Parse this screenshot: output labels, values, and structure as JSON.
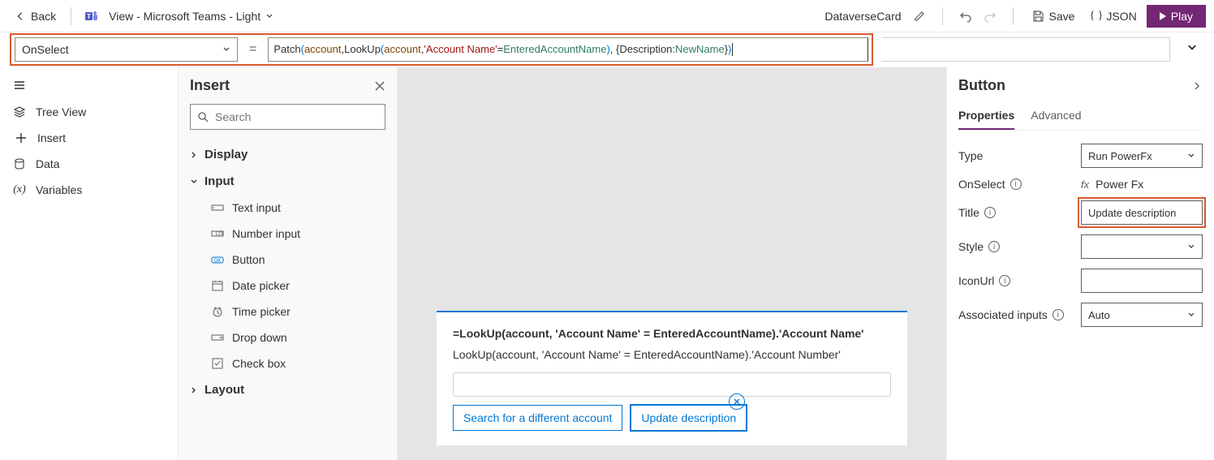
{
  "top": {
    "back": "Back",
    "view": "View - Microsoft Teams - Light",
    "dataverse": "DataverseCard",
    "save": "Save",
    "json": "JSON",
    "play": "Play"
  },
  "formula": {
    "property": "OnSelect",
    "fn1": "Patch",
    "ds": "account",
    "fn2": "LookUp",
    "field": "'Account Name'",
    "var1": "EnteredAccountName",
    "prop": "Description",
    "var2": "NewName"
  },
  "rail": {
    "treeview": "Tree View",
    "insert": "Insert",
    "data": "Data",
    "variables": "Variables"
  },
  "insert": {
    "title": "Insert",
    "search_placeholder": "Search",
    "cat_display": "Display",
    "cat_input": "Input",
    "cat_layout": "Layout",
    "items": {
      "text_input": "Text input",
      "number_input": "Number input",
      "button": "Button",
      "date_picker": "Date picker",
      "time_picker": "Time picker",
      "drop_down": "Drop down",
      "check_box": "Check box"
    }
  },
  "card": {
    "line1": "=LookUp(account, 'Account Name' = EnteredAccountName).'Account Name'",
    "line2": "LookUp(account, 'Account Name' = EnteredAccountName).'Account Number'",
    "btn1": "Search for a different account",
    "btn2": "Update description"
  },
  "right": {
    "heading": "Button",
    "tab_props": "Properties",
    "tab_adv": "Advanced",
    "type_label": "Type",
    "type_value": "Run PowerFx",
    "onselect_label": "OnSelect",
    "onselect_fx": "fx",
    "onselect_value": "Power Fx",
    "title_label": "Title",
    "title_value": "Update description",
    "style_label": "Style",
    "iconurl_label": "IconUrl",
    "assoc_label": "Associated inputs",
    "assoc_value": "Auto"
  }
}
